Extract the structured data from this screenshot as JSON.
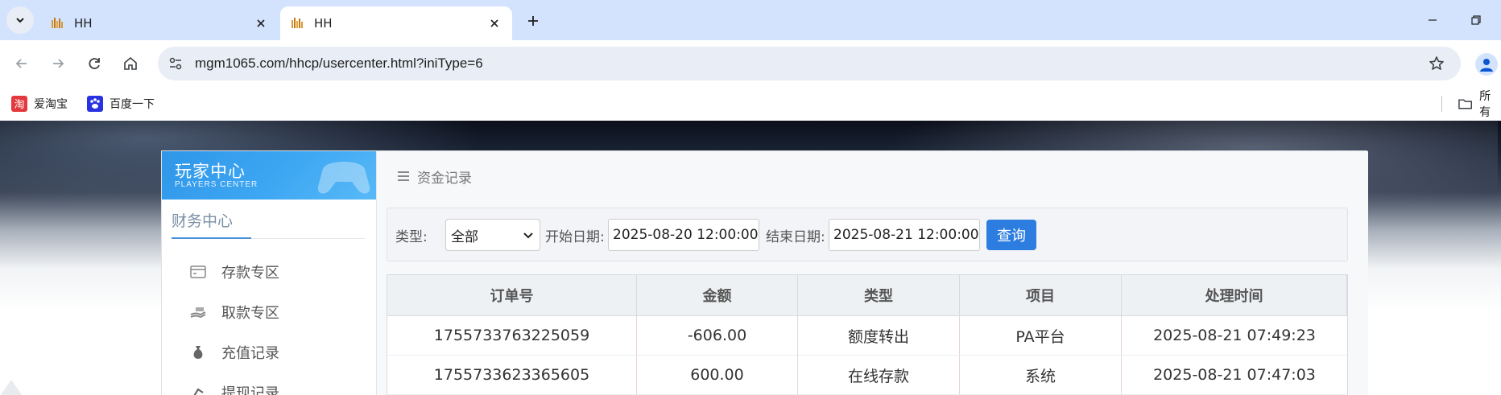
{
  "browser": {
    "tabs": [
      {
        "title": "HH",
        "active": false
      },
      {
        "title": "HH",
        "active": true
      }
    ],
    "url": "mgm1065.com/hhcp/usercenter.html?iniType=6",
    "bookmarks": [
      {
        "label": "爱淘宝",
        "icon": "taobao-icon"
      },
      {
        "label": "百度一下",
        "icon": "baidu-paw-icon"
      }
    ],
    "bookmarks_overflow": "所有"
  },
  "sidebar": {
    "brand_title": "玩家中心",
    "brand_subtitle": "PLAYERS CENTER",
    "section_title": "财务中心",
    "items": [
      {
        "label": "存款专区",
        "icon": "card-icon"
      },
      {
        "label": "取款专区",
        "icon": "hand-cash-icon"
      },
      {
        "label": "充值记录",
        "icon": "money-bag-icon"
      },
      {
        "label": "提现记录",
        "icon": "withdraw-icon"
      }
    ]
  },
  "content": {
    "heading": "资金记录",
    "filter": {
      "type_label": "类型:",
      "type_value": "全部",
      "start_label": "开始日期:",
      "start_value": "2025-08-20 12:00:00",
      "end_label": "结束日期:",
      "end_value": "2025-08-21 12:00:00",
      "query_label": "查询"
    },
    "table": {
      "headers": [
        "订单号",
        "金额",
        "类型",
        "项目",
        "处理时间"
      ],
      "rows": [
        [
          "1755733763225059",
          "-606.00",
          "额度转出",
          "PA平台",
          "2025-08-21 07:49:23"
        ],
        [
          "1755733623365605",
          "600.00",
          "在线存款",
          "系统",
          "2025-08-21 07:47:03"
        ]
      ]
    }
  },
  "colors": {
    "tabbar_bg": "#d3e3fd",
    "brand_blue": "#3ea7f3",
    "query_button": "#2d7de0"
  }
}
